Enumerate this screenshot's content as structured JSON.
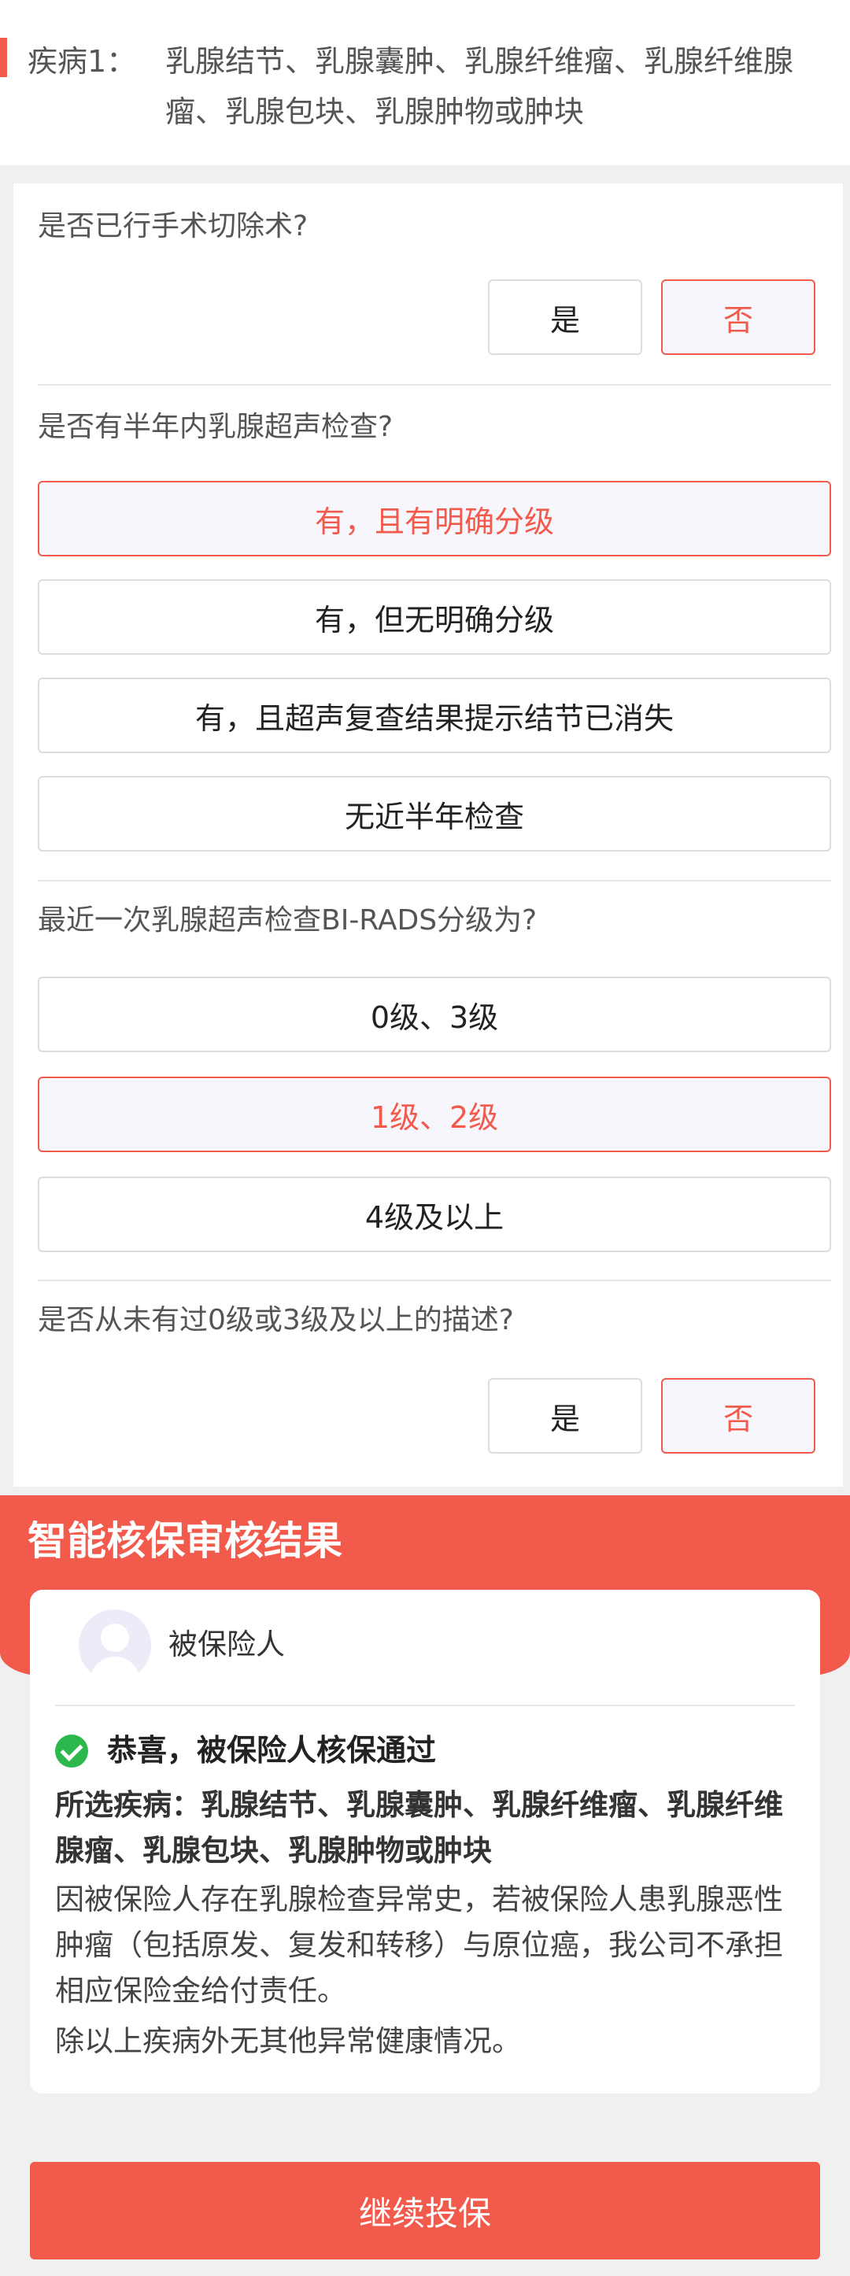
{
  "disease": {
    "label": "疾病1：",
    "names": "乳腺结节、乳腺囊肿、乳腺纤维瘤、乳腺纤维腺瘤、乳腺包块、乳腺肿物或肿块"
  },
  "questions": [
    {
      "text": "是否已行手术切除术?",
      "options": [
        {
          "label": "是",
          "selected": false
        },
        {
          "label": "否",
          "selected": true
        }
      ]
    },
    {
      "text": "是否有半年内乳腺超声检查?",
      "options": [
        {
          "label": "有，且有明确分级",
          "selected": true
        },
        {
          "label": "有，但无明确分级",
          "selected": false
        },
        {
          "label": "有，且超声复查结果提示结节已消失",
          "selected": false
        },
        {
          "label": "无近半年检查",
          "selected": false
        }
      ]
    },
    {
      "text": "最近一次乳腺超声检查BI-RADS分级为?",
      "options": [
        {
          "label": "0级、3级",
          "selected": false
        },
        {
          "label": "1级、2级",
          "selected": true
        },
        {
          "label": "4级及以上",
          "selected": false
        }
      ]
    },
    {
      "text": "是否从未有过0级或3级及以上的描述?",
      "options": [
        {
          "label": "是",
          "selected": false
        },
        {
          "label": "否",
          "selected": true
        }
      ]
    }
  ],
  "result": {
    "title": "智能核保审核结果",
    "insured_label": "被保险人",
    "pass_text": "恭喜，被保险人核保通过",
    "selected_diseases": "所选疾病：乳腺结节、乳腺囊肿、乳腺纤维瘤、乳腺纤维腺瘤、乳腺包块、乳腺肿物或肿块",
    "note": "因被保险人存在乳腺检查异常史，若被保险人患乳腺恶性肿瘤（包括原发、复发和转移）与原位癌，我公司不承担相应保险金给付责任。",
    "note2": "除以上疾病外无其他异常健康情况。"
  },
  "continue_label": "继续投保",
  "colors": {
    "accent": "#f25a4c",
    "success": "#2db84d",
    "selected_bg": "#f7f6fd"
  }
}
